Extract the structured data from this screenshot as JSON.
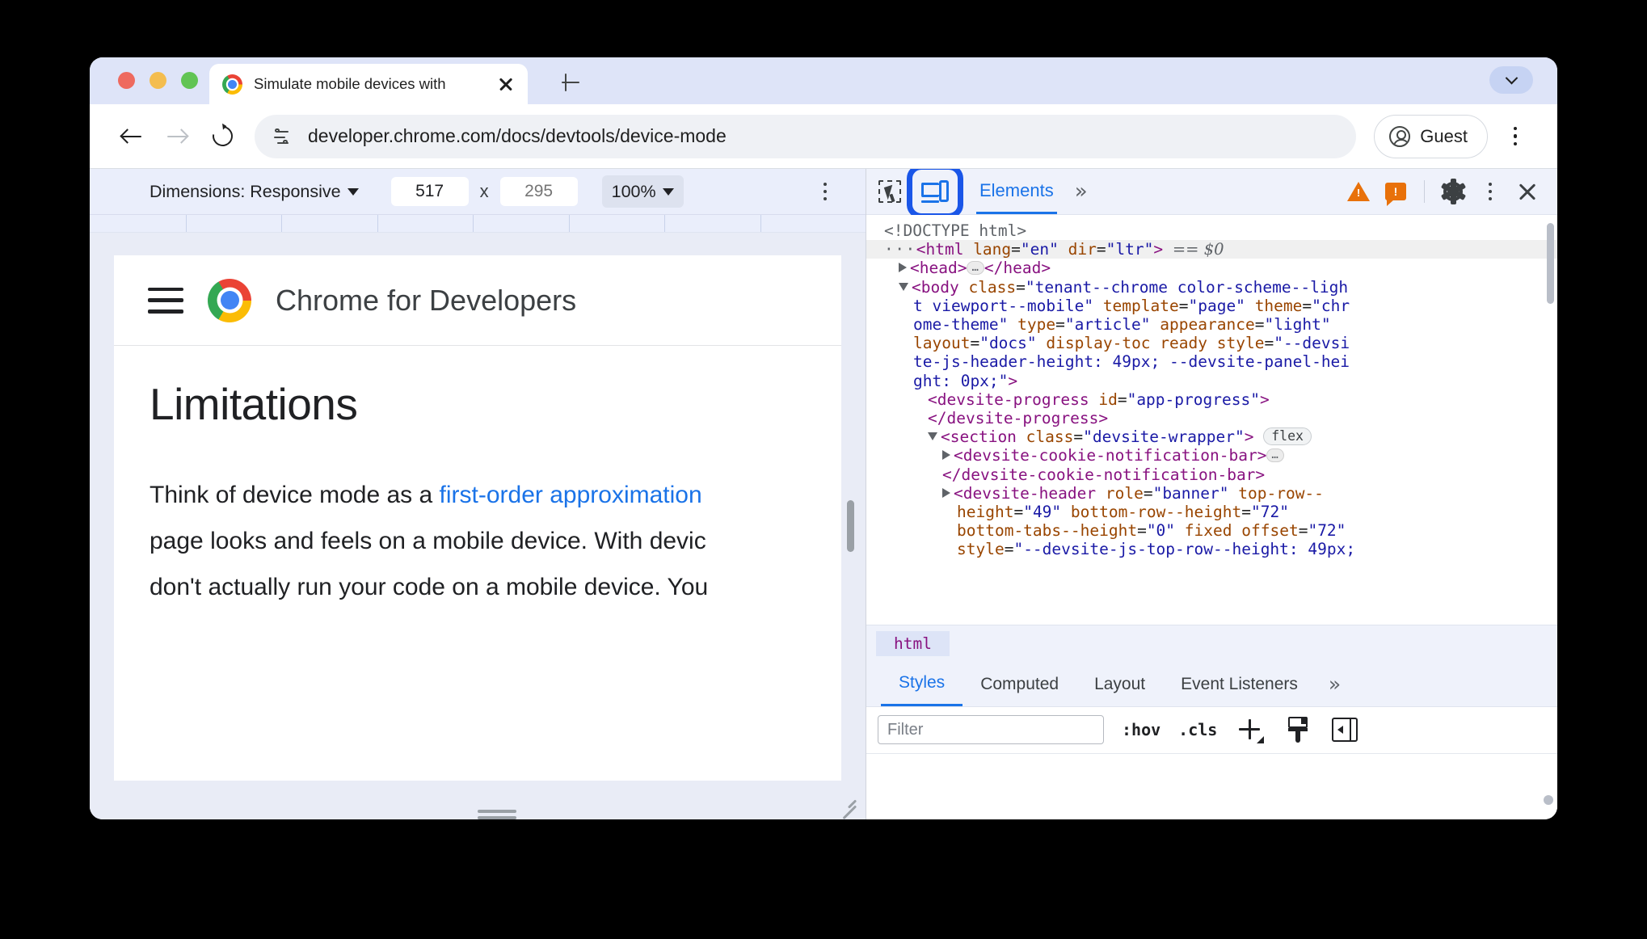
{
  "browser": {
    "tab": {
      "title": "Simulate mobile devices with",
      "close_label": "close-tab"
    },
    "omnibox": {
      "url": "developer.chrome.com/docs/devtools/device-mode"
    },
    "profile": {
      "label": "Guest"
    }
  },
  "device_toolbar": {
    "dimensions_label": "Dimensions: Responsive",
    "width_value": "517",
    "separator": "x",
    "height_placeholder": "295",
    "zoom_label": "100%"
  },
  "rendered_page": {
    "brand": "Chrome for Developers",
    "heading": "Limitations",
    "paragraph_lines": [
      {
        "before": "Think of device mode as a ",
        "link": "first-order approximation",
        "after": ""
      },
      {
        "before": "page looks and feels on a mobile device. With devic",
        "link": "",
        "after": ""
      },
      {
        "before": "don't actually run your code on a mobile device. You",
        "link": "",
        "after": ""
      }
    ]
  },
  "devtools": {
    "tab_elements": "Elements",
    "more_tabs": "»",
    "dom_lines": [
      {
        "indent": 0,
        "html": "<span class='tok-dim'>&lt;!DOCTYPE html&gt;</span>",
        "selected": false
      },
      {
        "indent": 0,
        "html": "<span class='ellipsis-plain'>···</span><span class='tok-tag'>&lt;html</span> <span class='tok-attr'>lang</span>=<span class='tok-val'>\"en\"</span> <span class='tok-attr'>dir</span>=<span class='tok-val'>\"ltr\"</span><span class='tok-tag'>&gt;</span> <span class='tok-ref'>== $0</span>",
        "selected": true
      },
      {
        "indent": 1,
        "html": "<span class='tri'></span><span class='tok-tag'>&lt;head&gt;</span><span class='ellipsis-pill'>…</span><span class='tok-tag'>&lt;/head&gt;</span>",
        "selected": false
      },
      {
        "indent": 1,
        "html": "<span class='tri open'></span><span class='tok-tag'>&lt;body</span> <span class='tok-attr'>class</span>=<span class='tok-val'>\"tenant--chrome color-scheme--ligh</span>",
        "selected": false
      },
      {
        "indent": 2,
        "html": "<span class='tok-val'>t viewport--mobile\"</span> <span class='tok-attr'>template</span>=<span class='tok-val'>\"page\"</span> <span class='tok-attr'>theme</span>=<span class='tok-val'>\"chr</span>",
        "selected": false
      },
      {
        "indent": 2,
        "html": "<span class='tok-val'>ome-theme\"</span> <span class='tok-attr'>type</span>=<span class='tok-val'>\"article\"</span> <span class='tok-attr'>appearance</span>=<span class='tok-val'>\"light\"</span>",
        "selected": false
      },
      {
        "indent": 2,
        "html": "<span class='tok-attr'>layout</span>=<span class='tok-val'>\"docs\"</span> <span class='tok-attr'>display-toc</span> <span class='tok-attr'>ready</span> <span class='tok-attr'>style</span>=<span class='tok-val'>\"--devsi</span>",
        "selected": false
      },
      {
        "indent": 2,
        "html": "<span class='tok-val'>te-js-header-height: 49px; --devsite-panel-hei</span>",
        "selected": false
      },
      {
        "indent": 2,
        "html": "<span class='tok-val'>ght: 0px;\"</span><span class='tok-tag'>&gt;</span>",
        "selected": false
      },
      {
        "indent": 3,
        "html": "<span class='tok-tag'>&lt;devsite-progress</span> <span class='tok-attr'>id</span>=<span class='tok-val'>\"app-progress\"</span><span class='tok-tag'>&gt;</span>",
        "selected": false
      },
      {
        "indent": 3,
        "html": "<span class='tok-tag'>&lt;/devsite-progress&gt;</span>",
        "selected": false
      },
      {
        "indent": 3,
        "html": "<span class='tri open'></span><span class='tok-tag'>&lt;section</span> <span class='tok-attr'>class</span>=<span class='tok-val'>\"devsite-wrapper\"</span><span class='tok-tag'>&gt;</span> <span class='badge-flex'>flex</span>",
        "selected": false
      },
      {
        "indent": 4,
        "html": "<span class='tri'></span><span class='tok-tag'>&lt;devsite-cookie-notification-bar&gt;</span><span class='ellipsis-pill'>…</span>",
        "selected": false
      },
      {
        "indent": 4,
        "html": "<span class='tok-tag'>&lt;/devsite-cookie-notification-bar&gt;</span>",
        "selected": false
      },
      {
        "indent": 4,
        "html": "<span class='tri'></span><span class='tok-tag'>&lt;devsite-header</span> <span class='tok-attr'>role</span>=<span class='tok-val'>\"banner\"</span> <span class='tok-attr'>top-row--</span>",
        "selected": false
      },
      {
        "indent": 5,
        "html": "<span class='tok-attr'>height</span>=<span class='tok-val'>\"49\"</span> <span class='tok-attr'>bottom-row--height</span>=<span class='tok-val'>\"72\"</span>",
        "selected": false
      },
      {
        "indent": 5,
        "html": "<span class='tok-attr'>bottom-tabs--height</span>=<span class='tok-val'>\"0\"</span> <span class='tok-attr'>fixed</span> <span class='tok-attr'>offset</span>=<span class='tok-val'>\"72\"</span>",
        "selected": false
      },
      {
        "indent": 5,
        "html": "<span class='tok-attr'>style</span>=<span class='tok-val'>\"--devsite-js-top-row--height: 49px;</span>",
        "selected": false
      }
    ],
    "breadcrumb": "html",
    "sidebar_tabs": [
      {
        "label": "Styles",
        "active": true
      },
      {
        "label": "Computed",
        "active": false
      },
      {
        "label": "Layout",
        "active": false
      },
      {
        "label": "Event Listeners",
        "active": false
      }
    ],
    "sidebar_more": "»",
    "styles_toolbar": {
      "filter_placeholder": "Filter",
      "hov_label": ":hov",
      "cls_label": ".cls"
    }
  },
  "colors": {
    "accent_blue": "#1a73e8",
    "highlight_ring": "#1a56e8",
    "warning_orange": "#e8710a",
    "tab_strip_bg": "#dee4f8",
    "devtools_bg": "#eff2fb"
  }
}
